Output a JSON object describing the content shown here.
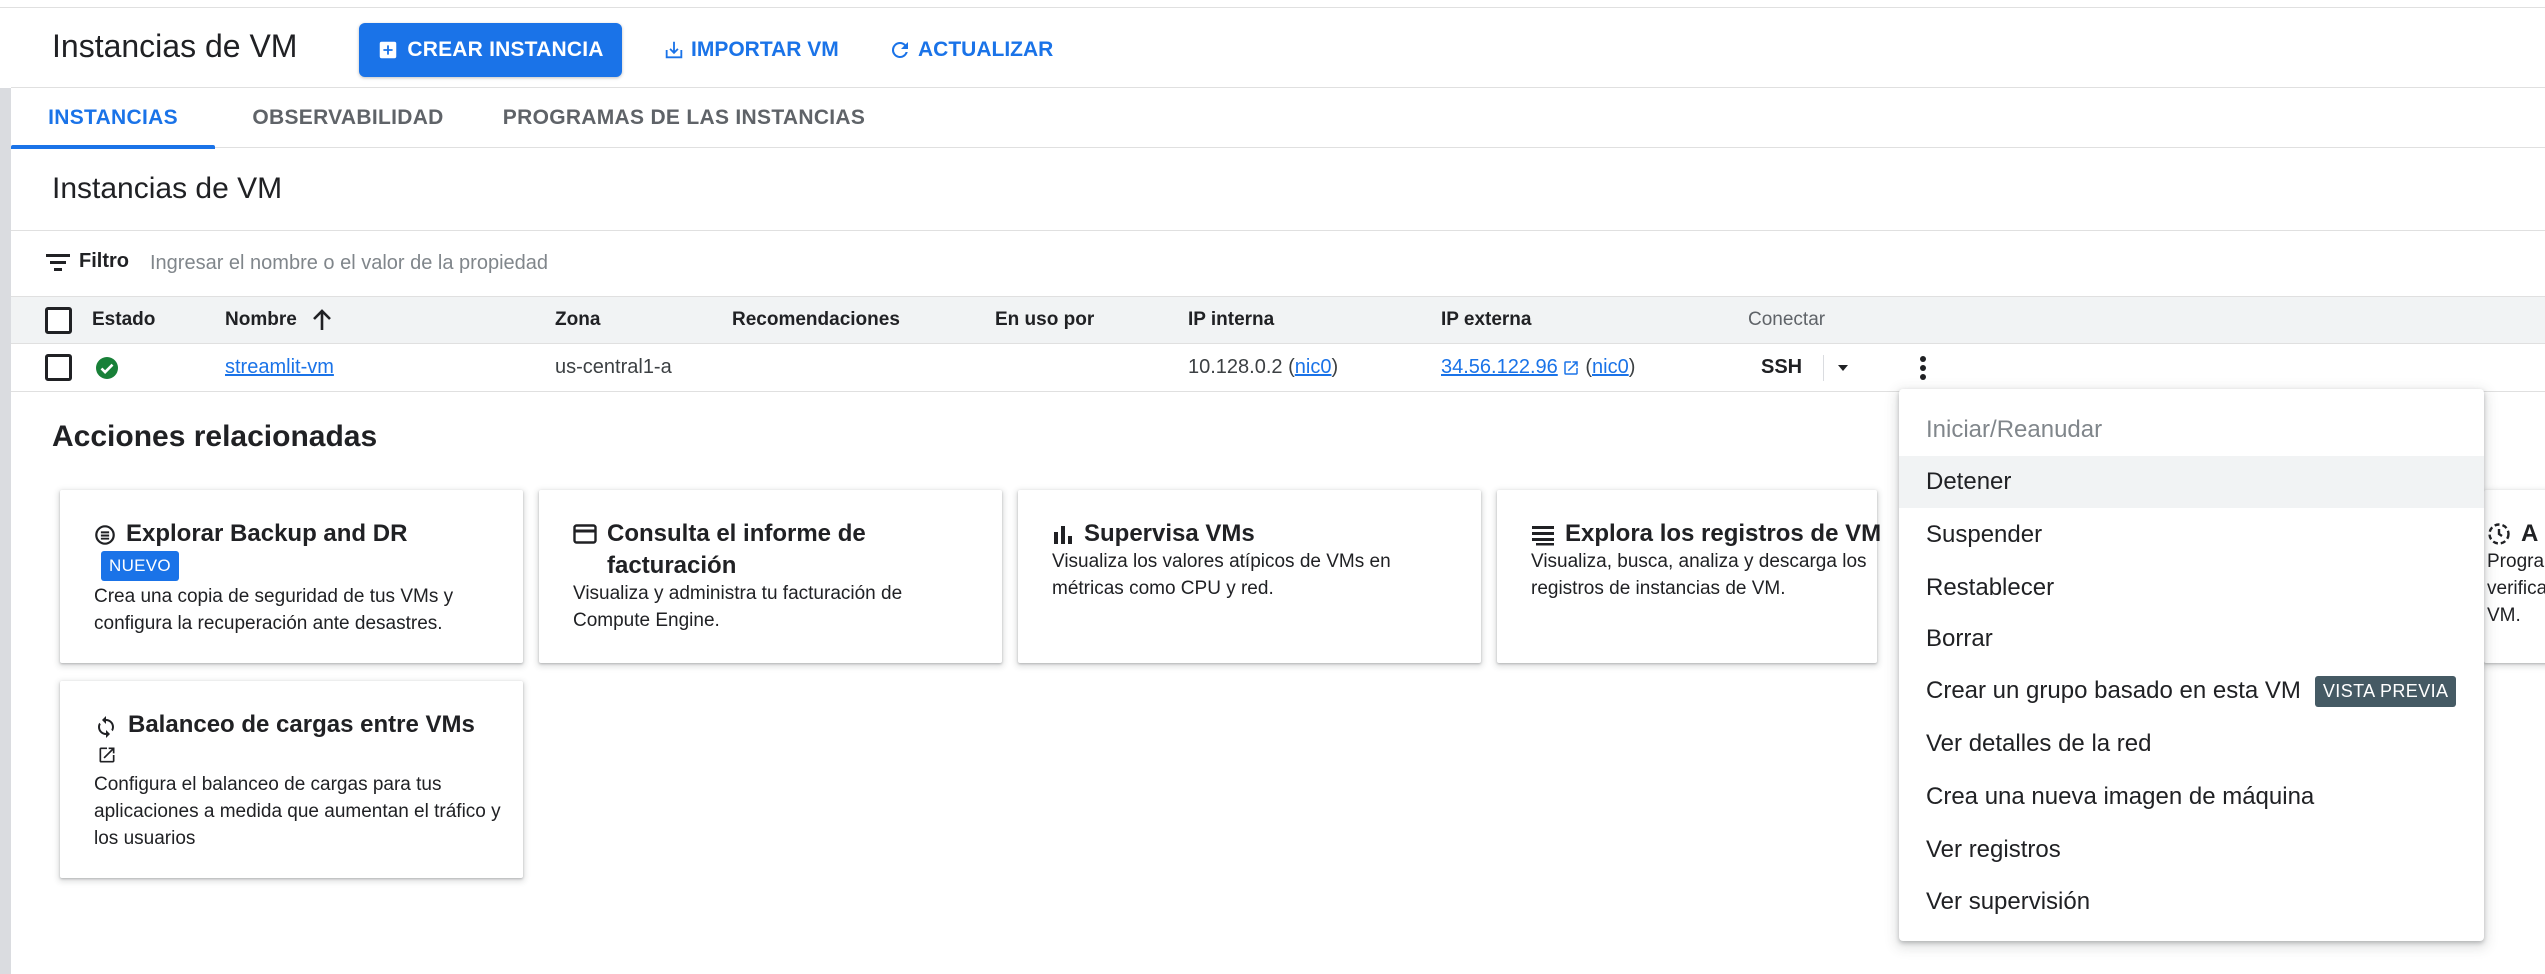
{
  "header": {
    "title": "Instancias de VM",
    "create_label": "CREAR INSTANCIA",
    "import_label": "IMPORTAR VM",
    "refresh_label": "ACTUALIZAR"
  },
  "tabs": [
    {
      "label": "INSTANCIAS",
      "active": true
    },
    {
      "label": "OBSERVABILIDAD",
      "active": false
    },
    {
      "label": "PROGRAMAS DE LAS INSTANCIAS",
      "active": false
    }
  ],
  "section_title": "Instancias de VM",
  "filter": {
    "label": "Filtro",
    "placeholder": "Ingresar el nombre o el valor de la propiedad"
  },
  "table": {
    "columns": [
      "Estado",
      "Nombre",
      "Zona",
      "Recomendaciones",
      "En uso por",
      "IP interna",
      "IP externa",
      "Conectar"
    ],
    "rows": [
      {
        "status": "running",
        "name": "streamlit-vm",
        "zone": "us-central1-a",
        "recommendations": "",
        "in_use_by": "",
        "internal_ip": "10.128.0.2",
        "internal_nic": "nic0",
        "external_ip": "34.56.122.96",
        "external_nic": "nic0",
        "connect": "SSH"
      }
    ]
  },
  "related": {
    "title": "Acciones relacionadas",
    "cards": [
      {
        "title": "Explorar Backup and DR",
        "badge": "NUEVO",
        "description": "Crea una copia de seguridad de tus VMs y configura la recuperación ante desastres.",
        "icon": "backup-icon"
      },
      {
        "title": "Consulta el informe de facturación",
        "description": "Visualiza y administra tu facturación de Compute Engine.",
        "icon": "billing-icon"
      },
      {
        "title": "Supervisa VMs",
        "description": "Visualiza los valores atípicos de VMs en métricas como CPU y red.",
        "icon": "bar-chart-icon"
      },
      {
        "title": "Explora los registros de VM",
        "description": "Visualiza, busca, analiza y descarga los registros de instancias de VM.",
        "icon": "logs-icon"
      },
      {
        "title": "Balanceo de cargas entre VMs",
        "description": "Configura el balanceo de cargas para tus aplicaciones a medida que aumentan el tráfico y los usuarios",
        "icon": "load-balance-icon"
      }
    ],
    "partial_card": {
      "title": "A",
      "lines": [
        "Progra",
        "verifica",
        "VM."
      ]
    }
  },
  "context_menu": {
    "items": [
      {
        "label": "Iniciar/Reanudar",
        "disabled": true
      },
      {
        "label": "Detener",
        "hover": true
      },
      {
        "label": "Suspender"
      },
      {
        "label": "Restablecer"
      },
      {
        "label": "Borrar"
      },
      {
        "label": "Crear un grupo basado en esta VM",
        "badge": "VISTA PREVIA"
      },
      {
        "label": "Ver detalles de la red"
      },
      {
        "label": "Crea una nueva imagen de máquina"
      },
      {
        "label": "Ver registros"
      },
      {
        "label": "Ver supervisión"
      }
    ]
  },
  "colors": {
    "accent": "#1a73e8",
    "status_ok": "#188038",
    "preview_badge": "#455a64"
  }
}
